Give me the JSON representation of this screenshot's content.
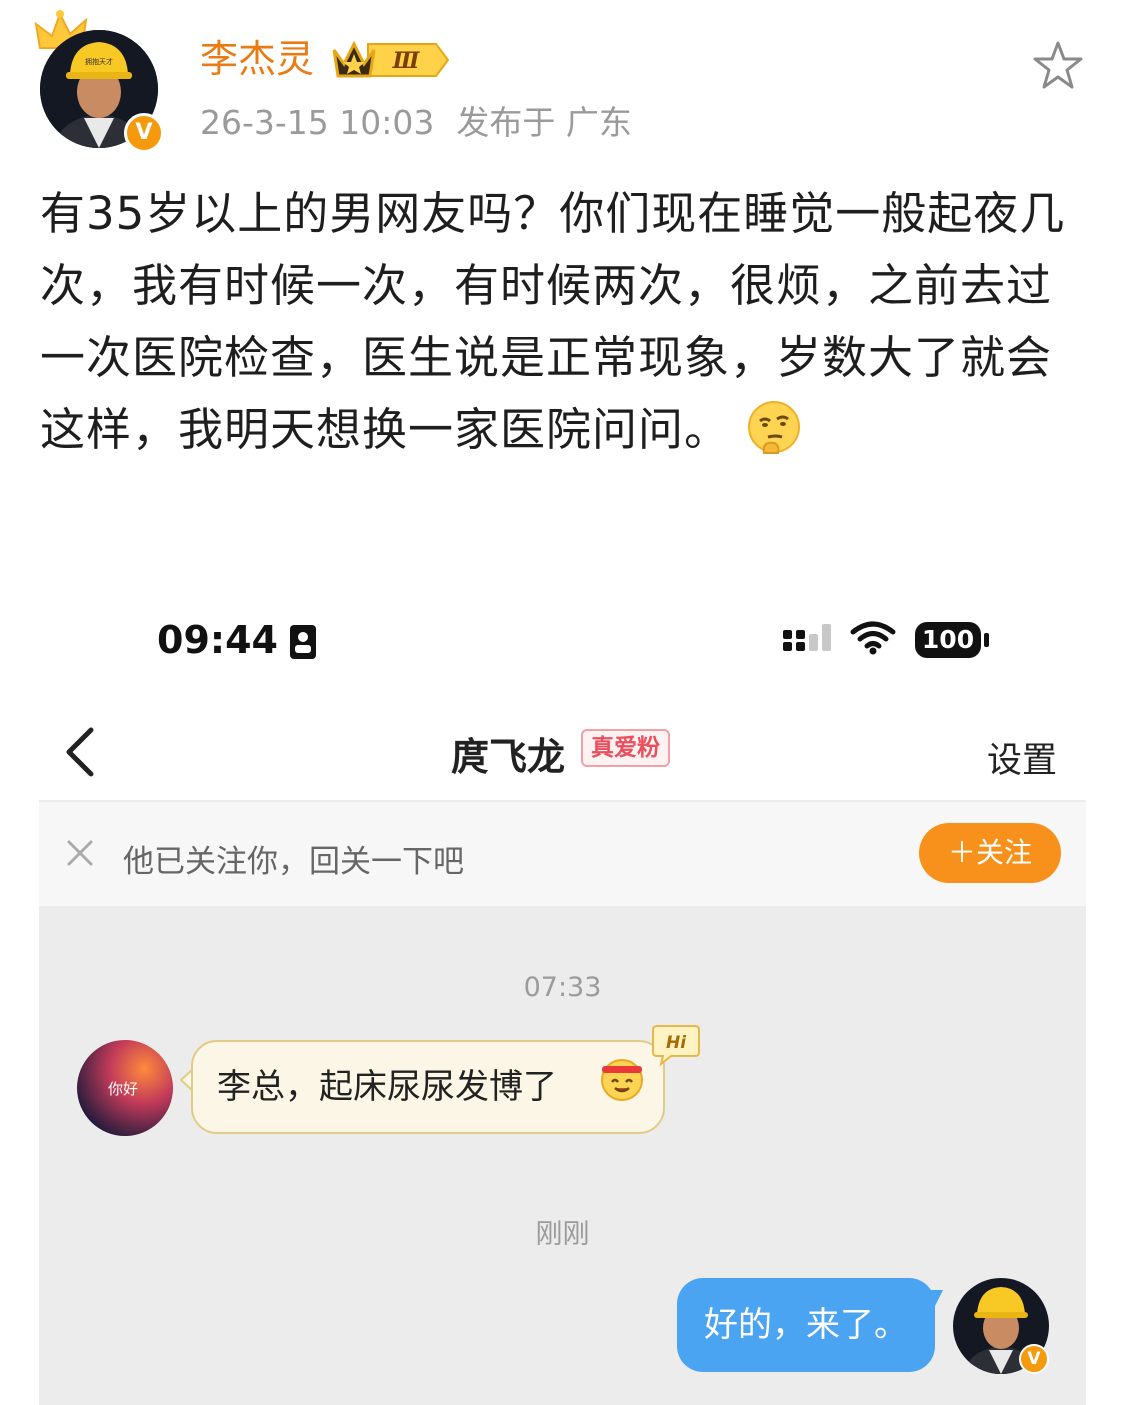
{
  "post": {
    "author": "李杰灵",
    "vip_level": "Ⅲ",
    "hat_text": "拥抱天才",
    "verified_mark": "V",
    "timestamp": "26-3-15 10:03",
    "location": "发布于 广东",
    "content": "有35岁以上的男网友吗？你们现在睡觉一般起夜几次，我有时候一次，有时候两次，很烦，之前去过一次医院检查，医生说是正常现象，岁数大了就会这样，我明天想换一家医院问问。",
    "content_emoji": "thinking-face-icon"
  },
  "screenshot": {
    "status_bar": {
      "time": "09:44",
      "battery": "100"
    },
    "nav": {
      "title": "庹飞龙",
      "fan_badge": "真爱粉",
      "settings": "设置"
    },
    "follow_bar": {
      "hint": "他已关注你，回关一下吧",
      "button": "＋关注"
    },
    "chat": {
      "messages": [
        {
          "time": "07:33",
          "sender": "other",
          "avatar_text": "你好",
          "text": "李总，起床尿尿发博了",
          "sticker_text": "Hi"
        },
        {
          "time": "刚刚",
          "sender": "me",
          "text": "好的，来了。"
        }
      ]
    }
  },
  "colors": {
    "username": "#ea7a14",
    "follow_button": "#f8911c",
    "my_bubble": "#4aa4f2",
    "their_bubble": "#fbf6e6",
    "chat_bg": "#ececec"
  }
}
